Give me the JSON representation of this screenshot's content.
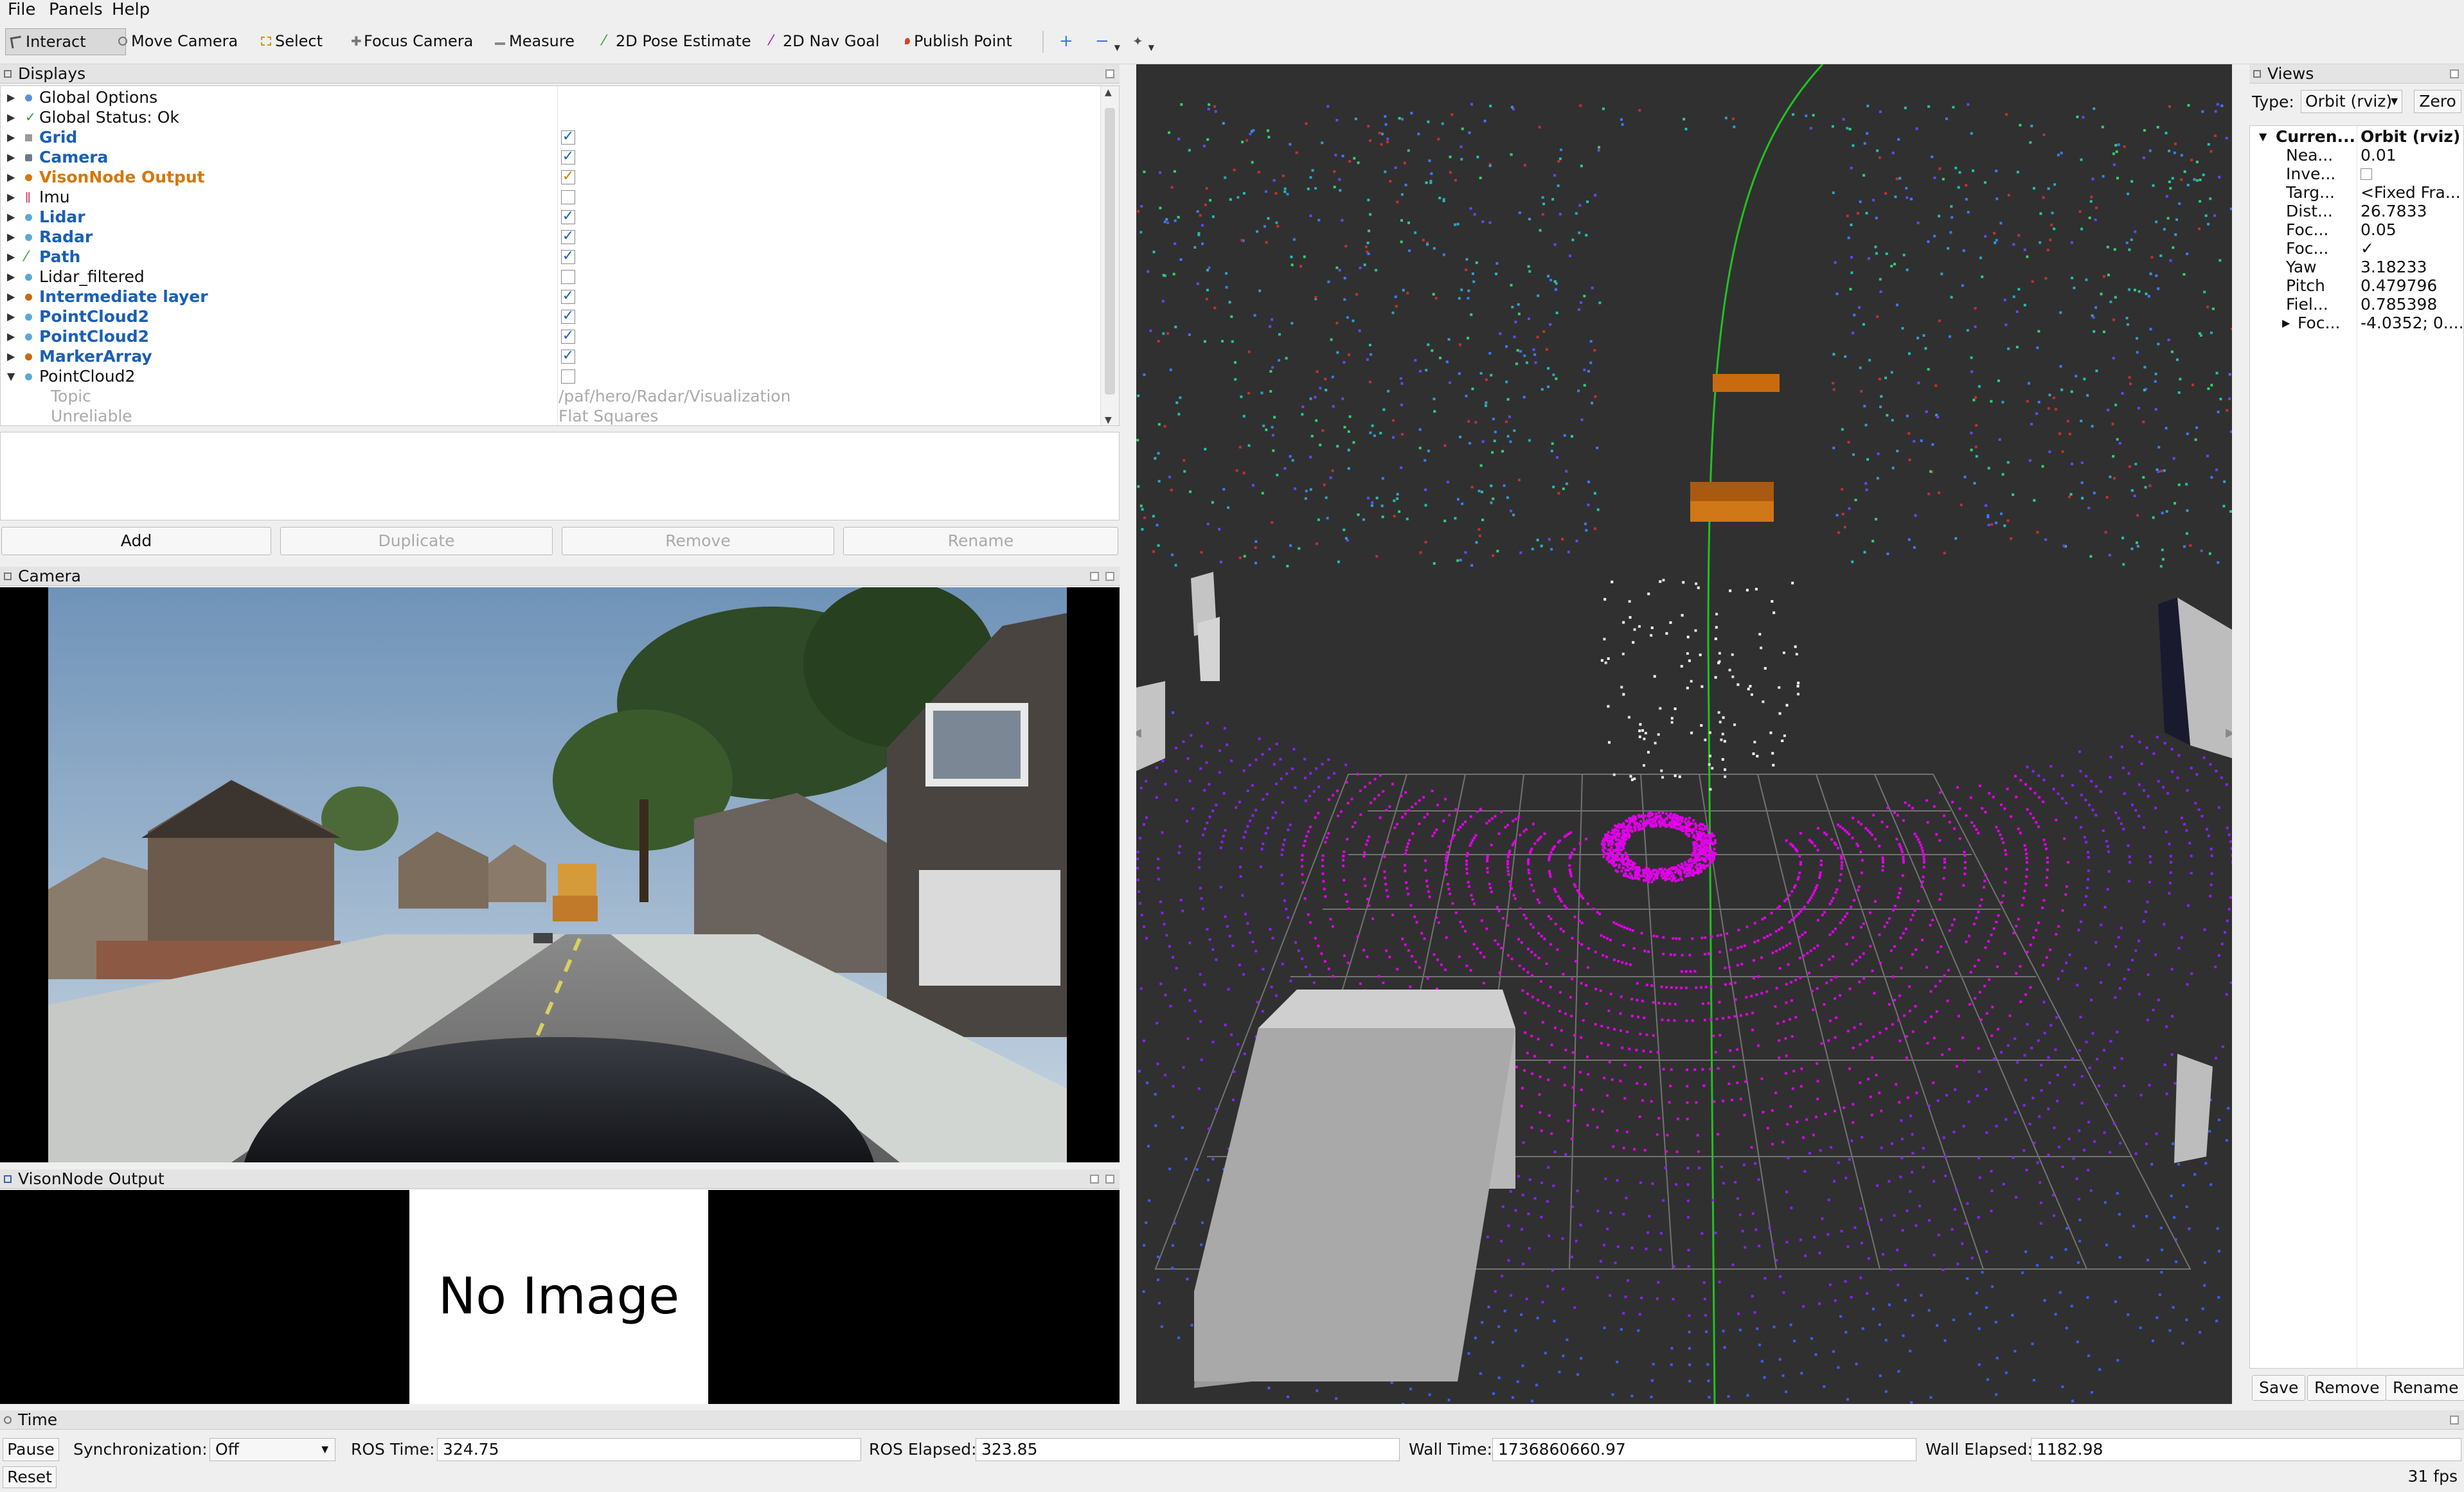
{
  "menu": [
    "File",
    "Panels",
    "Help"
  ],
  "toolbar": {
    "tools": [
      "Interact",
      "Move Camera",
      "Select",
      "Focus Camera",
      "Measure",
      "2D Pose Estimate",
      "2D Nav Goal",
      "Publish Point"
    ],
    "active": "Interact"
  },
  "displays": {
    "title": "Displays",
    "rows": [
      {
        "label": "Global Options",
        "icon_color": "#5b8fd6"
      },
      {
        "label": "Global Status: Ok",
        "icon_color": "#2e9a2e"
      },
      {
        "label": "Grid",
        "checked": true
      },
      {
        "label": "Camera",
        "checked": true
      },
      {
        "label": "VisonNode Output",
        "checked": true,
        "status": "warning"
      },
      {
        "label": "Imu",
        "checked": false
      },
      {
        "label": "Lidar",
        "checked": true
      },
      {
        "label": "Radar",
        "checked": true
      },
      {
        "label": "Path",
        "checked": true
      },
      {
        "label": "Lidar_filtered",
        "checked": false
      },
      {
        "label": "Intermediate layer",
        "checked": true
      },
      {
        "label": "PointCloud2",
        "checked": true
      },
      {
        "label": "PointCloud2",
        "checked": true
      },
      {
        "label": "MarkerArray",
        "checked": true
      },
      {
        "label": "PointCloud2",
        "checked": false,
        "expanded": true
      }
    ],
    "subrows": [
      {
        "key": "Topic",
        "value": "/paf/hero/Radar/Visualization"
      },
      {
        "key": "Unreliable",
        "value": "Flat Squares"
      }
    ],
    "buttons": [
      "Add",
      "Duplicate",
      "Remove",
      "Rename"
    ]
  },
  "camera_panel": {
    "title": "Camera"
  },
  "vision_panel": {
    "title": "VisonNode Output",
    "placeholder": "No Image"
  },
  "views": {
    "title": "Views",
    "type_label": "Type:",
    "type_value": "Orbit (rviz)",
    "zero_label": "Zero",
    "header_key": "Curren...",
    "header_value": "Orbit (rviz)",
    "props": [
      {
        "key": "Nea...",
        "value": "0.01"
      },
      {
        "key": "Inve...",
        "value": ""
      },
      {
        "key": "Targ...",
        "value": "<Fixed Fra..."
      },
      {
        "key": "Dist...",
        "value": "26.7833"
      },
      {
        "key": "Foc...",
        "value": "0.05"
      },
      {
        "key": "Foc...",
        "value": "✓"
      },
      {
        "key": "Yaw",
        "value": "3.18233"
      },
      {
        "key": "Pitch",
        "value": "0.479796"
      },
      {
        "key": "Fiel...",
        "value": "0.785398"
      },
      {
        "key": "Foc...",
        "value": "-4.0352; 0...."
      }
    ],
    "buttons": [
      "Save",
      "Remove",
      "Rename"
    ]
  },
  "time": {
    "title": "Time",
    "pause_label": "Pause",
    "sync_label": "Synchronization:",
    "sync_value": "Off",
    "ros_time_label": "ROS Time:",
    "ros_time": "324.75",
    "ros_elapsed_label": "ROS Elapsed:",
    "ros_elapsed": "323.85",
    "wall_time_label": "Wall Time:",
    "wall_time": "1736860660.97",
    "wall_elapsed_label": "Wall Elapsed:",
    "wall_elapsed": "1182.98",
    "reset_label": "Reset",
    "fps": "31 fps"
  },
  "colors": {
    "point_cloud_near": "#e000e8",
    "point_cloud_far": "#3c5cff",
    "path_line": "#22c022",
    "marker_box": "#c86a10",
    "obstacle_box": "#b8b8b8",
    "accent_blue": "#1a5fb4",
    "warning_orange": "#d4780a"
  }
}
